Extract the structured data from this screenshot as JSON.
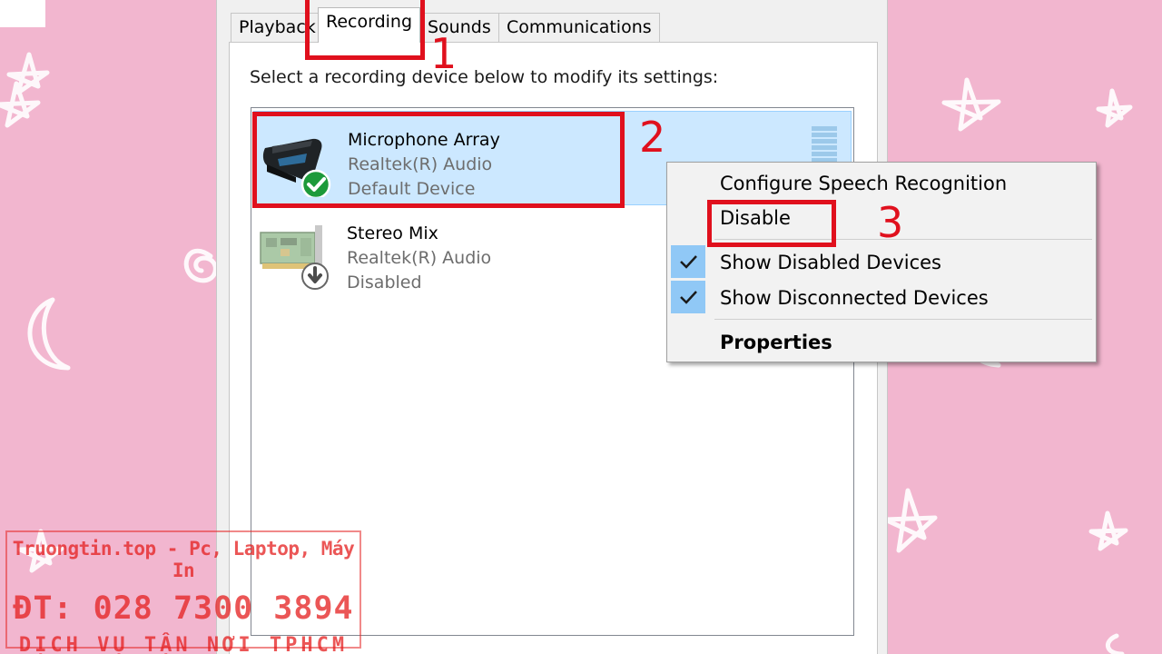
{
  "tabs": [
    {
      "label": "Playback"
    },
    {
      "label": "Recording"
    },
    {
      "label": "Sounds"
    },
    {
      "label": "Communications"
    }
  ],
  "instruction": "Select a recording device below to modify its settings:",
  "devices": [
    {
      "name": "Microphone Array",
      "driver": "Realtek(R) Audio",
      "status": "Default Device",
      "icon": "microphone-array-icon",
      "badge": "green-check-icon"
    },
    {
      "name": "Stereo Mix",
      "driver": "Realtek(R) Audio",
      "status": "Disabled",
      "icon": "sound-card-icon",
      "badge": "down-arrow-icon"
    }
  ],
  "context_menu": {
    "items": [
      {
        "label": "Configure Speech Recognition",
        "checked": false
      },
      {
        "label": "Disable",
        "checked": false
      },
      {
        "label": "Show Disabled Devices",
        "checked": true
      },
      {
        "label": "Show Disconnected Devices",
        "checked": true
      },
      {
        "label": "Properties",
        "checked": false,
        "bold": true
      }
    ]
  },
  "annotations": {
    "step1": "1",
    "step2": "2",
    "step3": "3"
  },
  "watermark": {
    "line1": "Truongtin.top - Pc, Laptop, Máy In",
    "line2": "ĐT: 028 7300 3894",
    "line3": "DỊCH VỤ TẬN NƠI TPHCM"
  },
  "colors": {
    "background": "#f2b6cf",
    "selection": "#cce8ff",
    "annotation_red": "#e0101d",
    "check_highlight": "#90c8f6"
  }
}
